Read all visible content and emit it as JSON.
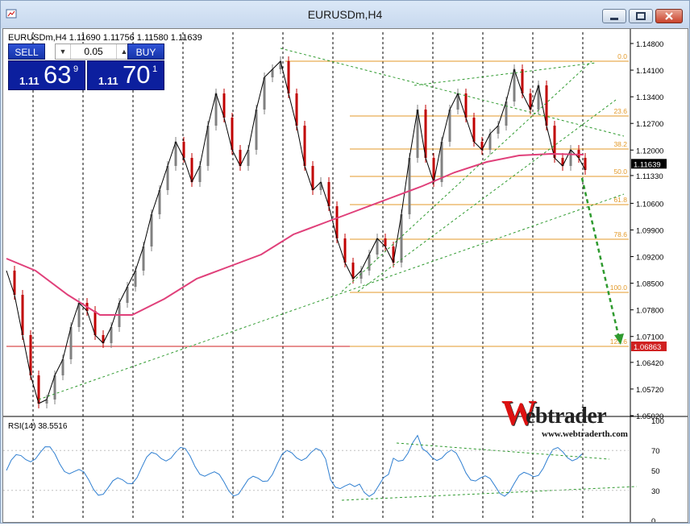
{
  "window": {
    "title": "EURUSDm,H4",
    "colors": {
      "frame": "#d6e3f2",
      "chart_bg": "#ffffff",
      "candle_up": "#808080",
      "candle_down": "#c00000",
      "ma_slow": "#e0407a",
      "fib": "#e39a2a",
      "support_line": "#d02020",
      "trend": "#2e9a2e"
    }
  },
  "chart": {
    "symbol_info": "EURUSDm,H4  1.11690 1.11756 1.11580 1.11639",
    "price_scale": [
      "1.14800",
      "1.14100",
      "1.13400",
      "1.12700",
      "1.12000",
      "1.11330",
      "1.10600",
      "1.09900",
      "1.09200",
      "1.08500",
      "1.07800",
      "1.07100",
      "1.06420",
      "1.05720",
      "1.05020"
    ],
    "current_price": "1.11639",
    "support_price": "1.06863",
    "fib_levels": [
      "0.0",
      "23.6",
      "38.2",
      "50.0",
      "61.8",
      "78.6",
      "100.0",
      "123.6"
    ]
  },
  "trade_panel": {
    "sell_label": "SELL",
    "buy_label": "BUY",
    "lot": "0.05",
    "bid_prefix": "1.11",
    "bid_main": "63",
    "bid_sup": "9",
    "ask_prefix": "1.11",
    "ask_main": "70",
    "ask_sup": "1"
  },
  "rsi": {
    "label": "RSI(14) 38.5516",
    "scale": [
      "100",
      "70",
      "50",
      "30",
      "0"
    ]
  },
  "logo": {
    "initial": "W",
    "name": "ebtrader",
    "url": "www.webtraderth.com"
  }
}
